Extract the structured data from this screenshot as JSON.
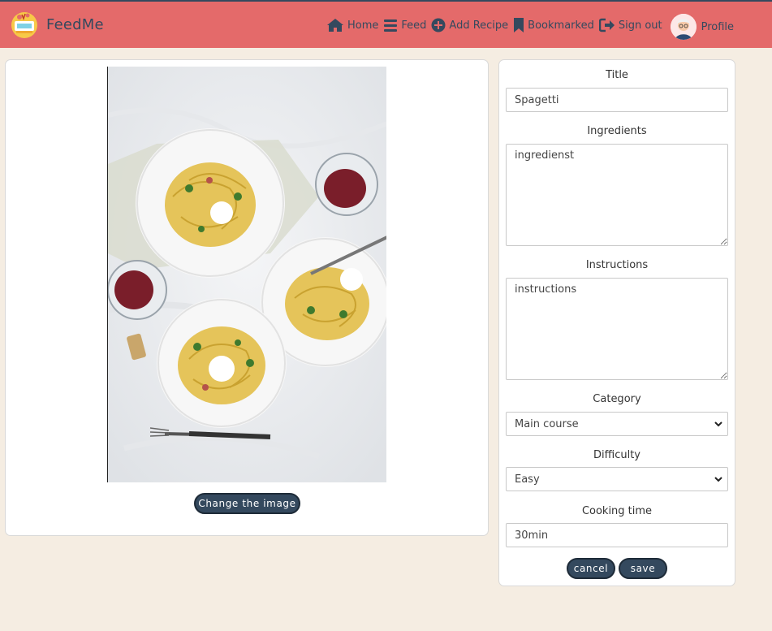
{
  "app": {
    "name": "FeedMe"
  },
  "nav": {
    "items": [
      {
        "label": "Home",
        "icon": "home-icon"
      },
      {
        "label": "Feed",
        "icon": "feed-icon"
      },
      {
        "label": "Add Recipe",
        "icon": "add-circle-icon"
      },
      {
        "label": "Bookmarked",
        "icon": "bookmark-icon"
      },
      {
        "label": "Sign out",
        "icon": "sign-out-icon"
      },
      {
        "label": "Profile",
        "icon": "avatar"
      }
    ]
  },
  "image_panel": {
    "change_label": "Change the image"
  },
  "form": {
    "title": {
      "label": "Title",
      "value": "Spagetti"
    },
    "ingredients": {
      "label": "Ingredients",
      "value": "ingredienst"
    },
    "instructions": {
      "label": "Instructions",
      "value": "instructions"
    },
    "category": {
      "label": "Category",
      "selected": "Main course"
    },
    "difficulty": {
      "label": "Difficulty",
      "selected": "Easy"
    },
    "cooking_time": {
      "label": "Cooking time",
      "value": "30min"
    },
    "cancel_label": "cancel",
    "save_label": "save"
  },
  "colors": {
    "navbar": "#e46a6a",
    "accent": "#34495e",
    "background": "#f5ede2"
  }
}
